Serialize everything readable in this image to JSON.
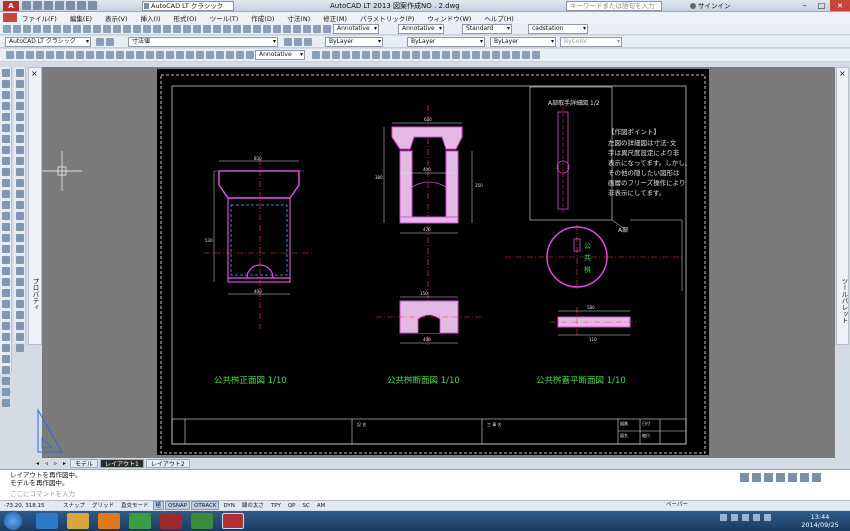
{
  "window": {
    "title": "AutoCAD LT 2013    図案作成NO . 2.dwg",
    "workspace": "AutoCAD LT クラシック",
    "search_placeholder": "キーワードまたは語句を入力",
    "signin": "サインイン",
    "controls": [
      "–",
      "□",
      "×"
    ]
  },
  "menu": [
    "ファイル(F)",
    "編集(E)",
    "表示(V)",
    "挿入(I)",
    "形式(O)",
    "ツール(T)",
    "作成(D)",
    "寸法(N)",
    "修正(M)",
    "パラメトリック(P)",
    "ウィンドウ(W)",
    "ヘルプ(H)"
  ],
  "toolbar": {
    "annotative_1": "Annotative",
    "annotative_2": "Annotative",
    "text_style": "Standard",
    "table_style": "cadstation",
    "workspace2": "AutoCAD LT クラシック",
    "layer_state": "寸法値",
    "annotative_3": "Annotative",
    "color": "ByLayer",
    "linetype": "ByLayer",
    "lineweight": "ByLayer",
    "plotstyle": "ByColor"
  },
  "drawing": {
    "front_title": "公共桝正面図  1/10",
    "section_title": "公共桝断面図  1/10",
    "lid_title": "公共桝蓋平断面図  1/10",
    "detail_title": "A部取手詳細図  1/2",
    "a_label": "A部",
    "lid_text": "公\n共\n桝",
    "note_title": "【作図ポイント】",
    "note_lines": [
      "左図の詳細図は寸法･文",
      "字は異尺度設定により非",
      "表示になってます。しかし、",
      "その他の隠したい図形は",
      "画層のフリーズ操作により",
      "非表示にしてます。"
    ],
    "title_block": {
      "cell_a": "図番",
      "cell_b": "記 名",
      "cell_c": "工 事 名",
      "cell_d": "図名",
      "cell_e": "尺 度",
      "cell_f": "縮尺",
      "cell_g": "日付",
      "cell_h": "番号"
    },
    "dims": {
      "w830": "830",
      "w400": "400",
      "w300": "300",
      "w100": "100",
      "w150": "150",
      "w470": "470",
      "w530": "530",
      "w350": "350",
      "w380": "380",
      "w30": "30",
      "w20": "20",
      "w620": "620",
      "w580": "580",
      "w110": "110"
    }
  },
  "tabs": {
    "model": "モデル",
    "layout1": "レイアウト1",
    "layout2": "レイアウト2"
  },
  "command": {
    "history": [
      "レイアウトを再作図中。",
      "モデルを再作図中。"
    ],
    "placeholder": "ここにコマンドを入力"
  },
  "status": {
    "coords": "-73.20, 318.15",
    "buttons": [
      "スナップ",
      "グリッド",
      "直交モード",
      "極",
      "OSNAP",
      "OTRACK",
      "DYN",
      "線の太さ",
      "TPY",
      "QP",
      "SC",
      "AM"
    ],
    "buttons_on": [
      3,
      4,
      5
    ],
    "paper": "ペーパー"
  },
  "taskbar": {
    "time": "13:44",
    "date": "2014/09/25"
  }
}
